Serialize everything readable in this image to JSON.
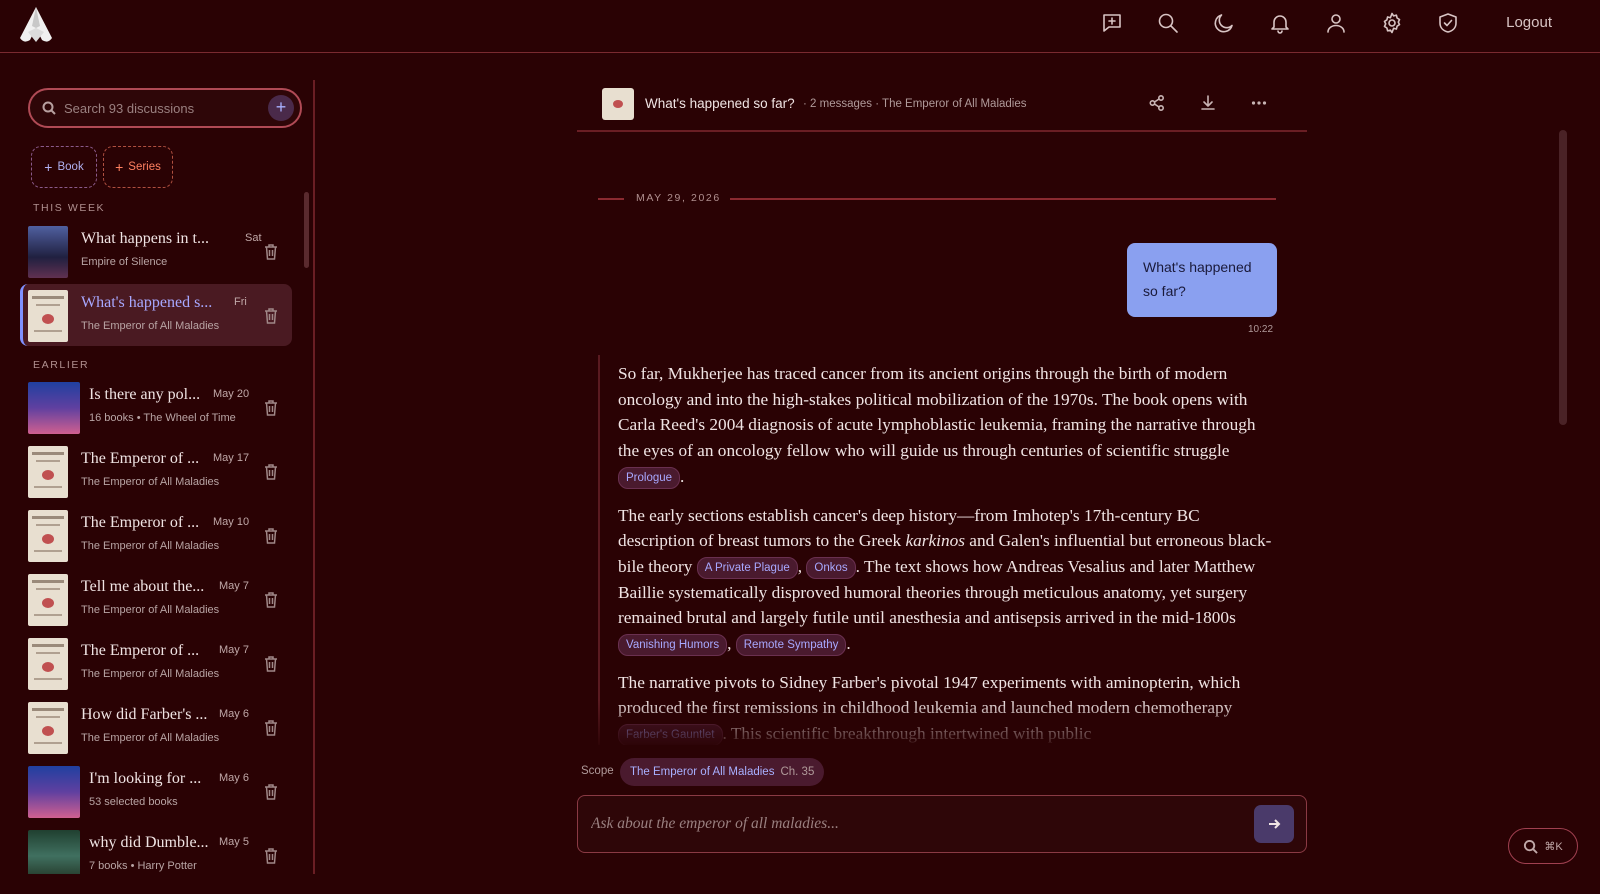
{
  "nav": {
    "logout_label": "Logout",
    "icons": [
      "new-chat-icon",
      "search-icon",
      "moon-icon",
      "bell-icon",
      "user-icon",
      "gear-icon",
      "shield-icon"
    ]
  },
  "sidebar": {
    "search_placeholder": "Search 93 discussions",
    "add_label": "+",
    "chips": {
      "book": "Book",
      "series": "Series"
    },
    "sections": {
      "this_week": "THIS WEEK",
      "earlier": "EARLIER"
    },
    "this_week": [
      {
        "title": "What happens in t...",
        "subtitle": "Empire of Silence",
        "date": "Sat"
      },
      {
        "title": "What's happened s...",
        "subtitle": "The Emperor of All Maladies",
        "date": "Fri",
        "active": true
      }
    ],
    "earlier": [
      {
        "title": "Is there any pol...",
        "subtitle": "16 books • The Wheel of Time",
        "date": "May 20"
      },
      {
        "title": "The Emperor of ...",
        "subtitle": "The Emperor of All Maladies",
        "date": "May 17"
      },
      {
        "title": "The Emperor of ...",
        "subtitle": "The Emperor of All Maladies",
        "date": "May 10"
      },
      {
        "title": "Tell me about the...",
        "subtitle": "The Emperor of All Maladies",
        "date": "May 7"
      },
      {
        "title": "The Emperor of ...",
        "subtitle": "The Emperor of All Maladies",
        "date": "May 7"
      },
      {
        "title": "How did Farber's ...",
        "subtitle": "The Emperor of All Maladies",
        "date": "May 6"
      },
      {
        "title": "I'm looking for ...",
        "subtitle": "53 selected books",
        "date": "May 6"
      },
      {
        "title": "why did Dumble...",
        "subtitle": "7 books • Harry Potter",
        "date": "May 5"
      }
    ]
  },
  "chat": {
    "title": "What's happened so far?",
    "meta": "· 2 messages · The Emperor of All Maladies",
    "date_divider": "MAY 29, 2026",
    "user_message": "What's happened so far?",
    "user_time": "10:22",
    "answer": {
      "p1_text": "So far, Mukherjee has traced cancer from its ancient origins through the birth of modern oncology and into the high-stakes political mobilization of the 1970s. The book opens with Carla Reed's 2004 diagnosis of acute lymphoblastic leukemia, framing the narrative through the eyes of an oncology fellow who will guide us through centuries of scientific struggle",
      "p1_cite": "Prologue",
      "p2_a": "The early sections establish cancer's deep history—from Imhotep's 17th-century BC description of breast tumors to the Greek ",
      "p2_em": "karkinos",
      "p2_b": " and Galen's influential but erroneous black-bile theory",
      "p2_cite1": "A Private Plague",
      "p2_cite2": "Onkos",
      "p2_c": ". The text shows how Andreas Vesalius and later Matthew Baillie systematically disproved humoral theories through meticulous anatomy, yet surgery remained brutal and largely futile until anesthesia and antisepsis arrived in the mid-1800s",
      "p2_cite3": "Vanishing Humors",
      "p2_cite4": "Remote Sympathy",
      "p3_text": "The narrative pivots to Sidney Farber's pivotal 1947 experiments with aminopterin, which produced the first remissions in childhood leukemia and launched modern chemotherapy",
      "p3_cite": "Farber's Gauntlet",
      "p3_tail": ". This scientific breakthrough intertwined with public"
    },
    "scope_label": "Scope",
    "scope_book": "The Emperor of All Maladies",
    "scope_chapter": "Ch. 35",
    "input_placeholder": "Ask about the emperor of all maladies...",
    "cmdk_label": "⌘K"
  },
  "colors": {
    "background": "#2a0204",
    "accent": "#8aa0f0",
    "citation": "#a8a8ff",
    "series_chip": "#ff8060"
  }
}
